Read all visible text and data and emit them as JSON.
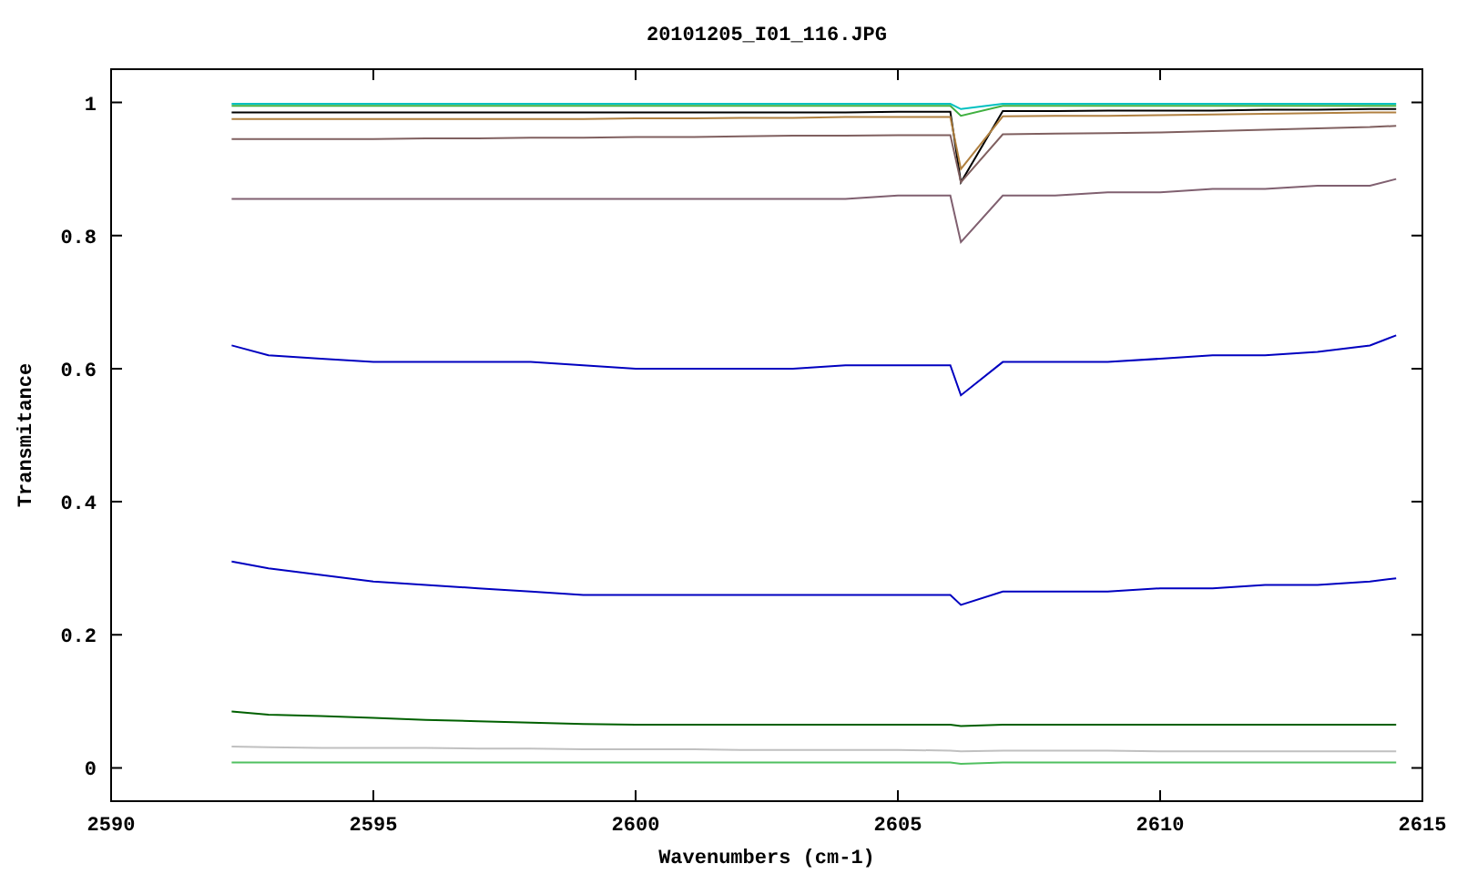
{
  "chart": {
    "chart_data": {
      "type": "line",
      "title": "20101205_I01_116.JPG",
      "xlabel": "Wavenumbers (cm-1)",
      "ylabel": "Transmitance",
      "x": [
        2592.3,
        2593,
        2594,
        2595,
        2596,
        2597,
        2598,
        2599,
        2600,
        2601,
        2602,
        2603,
        2604,
        2605,
        2606,
        2606.2,
        2607,
        2608,
        2609,
        2610,
        2611,
        2612,
        2613,
        2614,
        2614.5
      ],
      "xlim": [
        2590,
        2615
      ],
      "ylim": [
        -0.05,
        1.05
      ],
      "xticks": [
        2590,
        2595,
        2600,
        2605,
        2610,
        2615
      ],
      "yticks": [
        0,
        {
          "value": 0.2,
          "label": "0.2"
        },
        {
          "value": 0.4,
          "label": "0.4"
        },
        {
          "value": 0.6,
          "label": "0.6"
        },
        {
          "value": 0.8,
          "label": "0.8"
        },
        1
      ],
      "series": [
        {
          "color": "#00c0c0",
          "values": [
            0.998,
            0.998,
            0.998,
            0.998,
            0.998,
            0.998,
            0.998,
            0.998,
            0.998,
            0.998,
            0.998,
            0.998,
            0.998,
            0.998,
            0.998,
            0.99,
            0.998,
            0.998,
            0.998,
            0.998,
            0.998,
            0.998,
            0.998,
            0.998,
            0.998
          ]
        },
        {
          "color": "#40b040",
          "values": [
            0.995,
            0.995,
            0.995,
            0.995,
            0.995,
            0.995,
            0.995,
            0.995,
            0.995,
            0.995,
            0.995,
            0.995,
            0.995,
            0.995,
            0.995,
            0.98,
            0.995,
            0.995,
            0.995,
            0.995,
            0.995,
            0.995,
            0.995,
            0.995,
            0.995
          ]
        },
        {
          "color": "#000000",
          "values": [
            0.985,
            0.985,
            0.985,
            0.985,
            0.985,
            0.985,
            0.985,
            0.985,
            0.985,
            0.985,
            0.985,
            0.985,
            0.985,
            0.986,
            0.986,
            0.88,
            0.987,
            0.987,
            0.988,
            0.988,
            0.988,
            0.989,
            0.989,
            0.99,
            0.99
          ]
        },
        {
          "color": "#b08040",
          "values": [
            0.975,
            0.975,
            0.975,
            0.975,
            0.975,
            0.975,
            0.975,
            0.975,
            0.976,
            0.976,
            0.977,
            0.977,
            0.978,
            0.978,
            0.978,
            0.9,
            0.979,
            0.98,
            0.98,
            0.981,
            0.982,
            0.983,
            0.984,
            0.985,
            0.985
          ]
        },
        {
          "color": "#806060",
          "values": [
            0.945,
            0.945,
            0.945,
            0.945,
            0.946,
            0.946,
            0.947,
            0.947,
            0.948,
            0.948,
            0.949,
            0.95,
            0.95,
            0.951,
            0.951,
            0.88,
            0.952,
            0.953,
            0.954,
            0.955,
            0.957,
            0.959,
            0.961,
            0.963,
            0.965
          ]
        },
        {
          "color": "#806070",
          "values": [
            0.855,
            0.855,
            0.855,
            0.855,
            0.855,
            0.855,
            0.855,
            0.855,
            0.855,
            0.855,
            0.855,
            0.855,
            0.855,
            0.86,
            0.86,
            0.79,
            0.86,
            0.86,
            0.865,
            0.865,
            0.87,
            0.87,
            0.875,
            0.875,
            0.885
          ]
        },
        {
          "color": "#0000c0",
          "values": [
            0.635,
            0.62,
            0.615,
            0.61,
            0.61,
            0.61,
            0.61,
            0.605,
            0.6,
            0.6,
            0.6,
            0.6,
            0.605,
            0.605,
            0.605,
            0.56,
            0.61,
            0.61,
            0.61,
            0.615,
            0.62,
            0.62,
            0.625,
            0.635,
            0.65
          ]
        },
        {
          "color": "#0000c0",
          "values": [
            0.31,
            0.3,
            0.29,
            0.28,
            0.275,
            0.27,
            0.265,
            0.26,
            0.26,
            0.26,
            0.26,
            0.26,
            0.26,
            0.26,
            0.26,
            0.245,
            0.265,
            0.265,
            0.265,
            0.27,
            0.27,
            0.275,
            0.275,
            0.28,
            0.285
          ]
        },
        {
          "color": "#006000",
          "values": [
            0.085,
            0.08,
            0.078,
            0.075,
            0.072,
            0.07,
            0.068,
            0.066,
            0.065,
            0.065,
            0.065,
            0.065,
            0.065,
            0.065,
            0.065,
            0.063,
            0.065,
            0.065,
            0.065,
            0.065,
            0.065,
            0.065,
            0.065,
            0.065,
            0.065
          ]
        },
        {
          "color": "#c0c0c0",
          "values": [
            0.032,
            0.031,
            0.03,
            0.03,
            0.03,
            0.029,
            0.029,
            0.028,
            0.028,
            0.028,
            0.027,
            0.027,
            0.027,
            0.027,
            0.026,
            0.025,
            0.026,
            0.026,
            0.026,
            0.025,
            0.025,
            0.025,
            0.025,
            0.025,
            0.025
          ]
        },
        {
          "color": "#50c060",
          "values": [
            0.008,
            0.008,
            0.008,
            0.008,
            0.008,
            0.008,
            0.008,
            0.008,
            0.008,
            0.008,
            0.008,
            0.008,
            0.008,
            0.008,
            0.008,
            0.006,
            0.008,
            0.008,
            0.008,
            0.008,
            0.008,
            0.008,
            0.008,
            0.008,
            0.008
          ]
        }
      ]
    }
  }
}
